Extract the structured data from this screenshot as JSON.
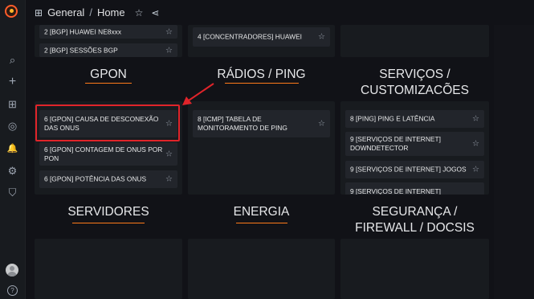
{
  "breadcrumb": {
    "folder": "General",
    "separator": "/",
    "dashboard": "Home"
  },
  "sidebar_icons": [
    "search-icon",
    "plus-icon",
    "dashboards-icon",
    "explore-icon",
    "alerting-icon",
    "settings-icon",
    "shield-icon",
    "avatar",
    "help-icon"
  ],
  "sidebar_glyphs": {
    "search": "⌕",
    "plus": "+",
    "dashboards": "⊞",
    "explore": "◎",
    "alert": "🔔",
    "settings": "⚙",
    "shield": "⛉",
    "help": "?"
  },
  "top_glyphs": {
    "grid": "⊞",
    "star": "☆",
    "share": "⋖"
  },
  "star_glyph": "☆",
  "top_links": {
    "col1": [
      "2 [BGP] HUAWEI NE8xxx",
      "2 [BGP] SESSÕES BGP"
    ],
    "col2": [
      "4 [CONCENTRADORES] HUAWEI"
    ]
  },
  "rows": {
    "gpon": "GPON",
    "radios": "RÁDIOS / PING",
    "servicos": "SERVIÇOS / CUSTOMIZAÇÕES",
    "servidores": "SERVIDORES",
    "energia": "ENERGIA",
    "seguranca": "SEGURANÇA / FIREWALL / DOCSIS"
  },
  "gpon_links": [
    "6 [GPON] CAUSA DE DESCONEXÃO DAS ONUS",
    "6 [GPON] CONTAGEM DE ONUS POR PON",
    "6 [GPON] POTÊNCIA DAS ONUS"
  ],
  "radios_links": [
    "8 [ICMP] TABELA DE MONITORAMENTO DE PING"
  ],
  "servicos_links": [
    "8 [PING] PING E LATÊNCIA",
    "9 [SERVIÇOS DE INTERNET] DOWNDETECTOR",
    "9 [SERVIÇOS DE INTERNET] JOGOS",
    "9 [SERVIÇOS DE INTERNET]"
  ],
  "colors": {
    "accent": "#ff7a1a",
    "highlight": "#e0242a"
  }
}
